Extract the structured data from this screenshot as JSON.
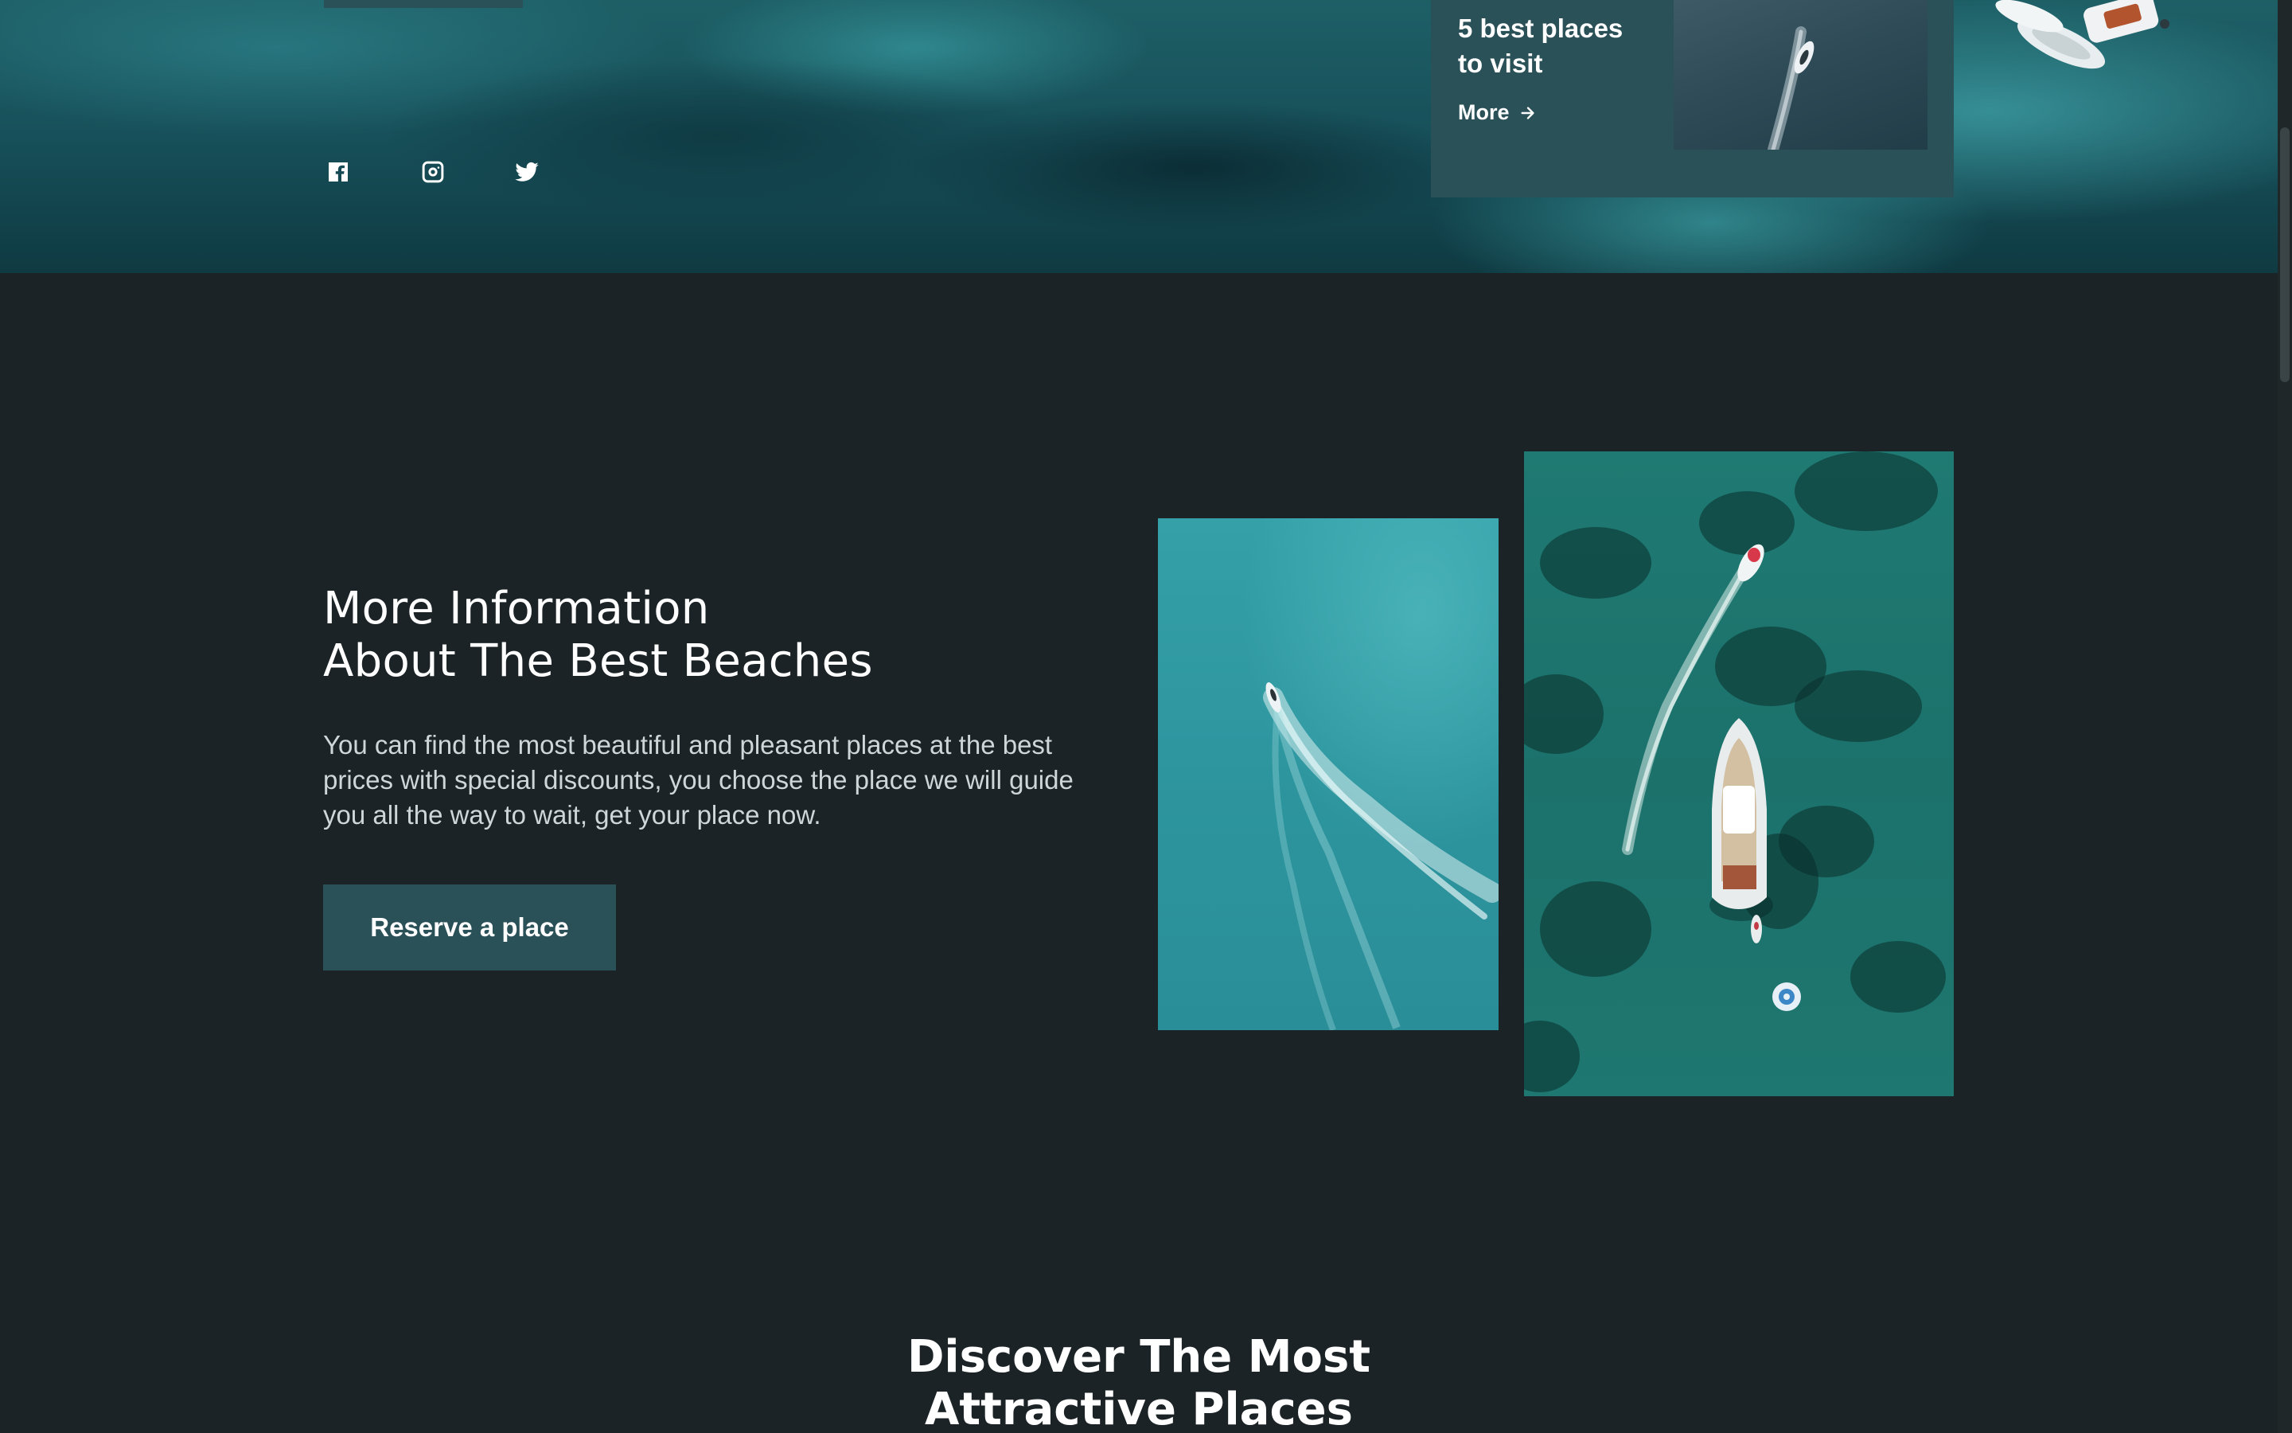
{
  "hero": {
    "social": [
      {
        "icon": "facebook-icon"
      },
      {
        "icon": "instagram-icon"
      },
      {
        "icon": "twitter-icon"
      }
    ],
    "card": {
      "title": "5 best places to visit",
      "more_label": "More"
    }
  },
  "info": {
    "title_line1": "More Information",
    "title_line2": "About The Best Beaches",
    "text": "You can find the most beautiful and pleasant places at the best prices with special discounts, you choose the place we will guide you all the way to wait, get your place now.",
    "button_label": "Reserve a place"
  },
  "discover": {
    "title_line1": "Discover The Most",
    "title_line2": "Attractive Places"
  },
  "colors": {
    "background": "#1b2326",
    "accent": "#2b5158",
    "text": "#ffffff",
    "muted_text": "#cfd6d8"
  }
}
